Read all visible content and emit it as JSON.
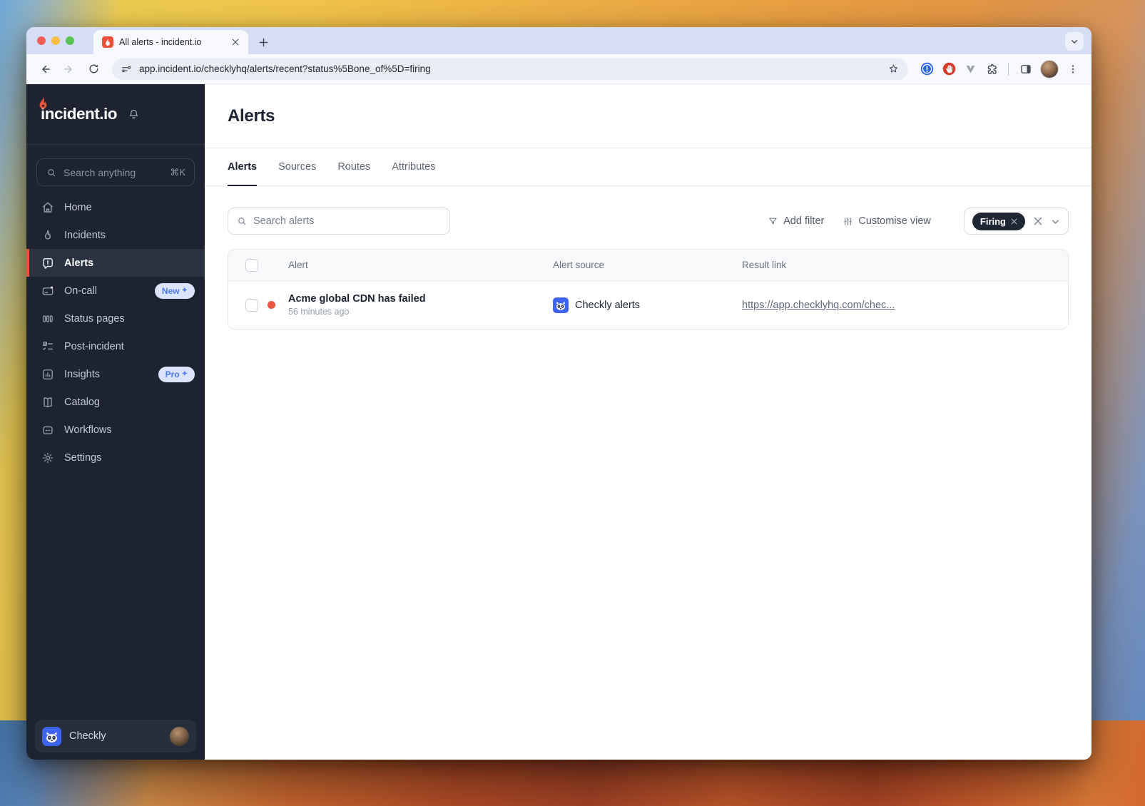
{
  "browser": {
    "tab_title": "All alerts - incident.io",
    "url": "app.incident.io/checklyhq/alerts/recent?status%5Bone_of%5D=firing"
  },
  "sidebar": {
    "logo_text": "incident.io",
    "search_placeholder": "Search anything",
    "search_shortcut": "⌘K",
    "items": [
      {
        "label": "Home"
      },
      {
        "label": "Incidents"
      },
      {
        "label": "Alerts"
      },
      {
        "label": "On-call",
        "badge": "New"
      },
      {
        "label": "Status pages"
      },
      {
        "label": "Post-incident"
      },
      {
        "label": "Insights",
        "badge": "Pro"
      },
      {
        "label": "Catalog"
      },
      {
        "label": "Workflows"
      },
      {
        "label": "Settings"
      }
    ],
    "sparkle": "✦",
    "workspace": "Checkly"
  },
  "main": {
    "title": "Alerts",
    "tabs": [
      {
        "label": "Alerts"
      },
      {
        "label": "Sources"
      },
      {
        "label": "Routes"
      },
      {
        "label": "Attributes"
      }
    ],
    "controls": {
      "search_placeholder": "Search alerts",
      "add_filter": "Add filter",
      "customise_view": "Customise view",
      "filter_chip": "Firing"
    },
    "table": {
      "columns": [
        "Alert",
        "Alert source",
        "Result link"
      ],
      "rows": [
        {
          "title": "Acme global CDN has failed",
          "time": "56 minutes ago",
          "source": "Checkly alerts",
          "link": "https://app.checklyhq.com/chec..."
        }
      ]
    }
  },
  "colors": {
    "accent_orange": "#e8543b",
    "sidebar_bg": "#1d2330",
    "badge_blue": "#4c7cf6",
    "firing_pill_bg": "#1f2734",
    "checkly_blue": "#3e63f0",
    "alert_dot": "#ec5742",
    "link_gray": "#5f6879"
  }
}
